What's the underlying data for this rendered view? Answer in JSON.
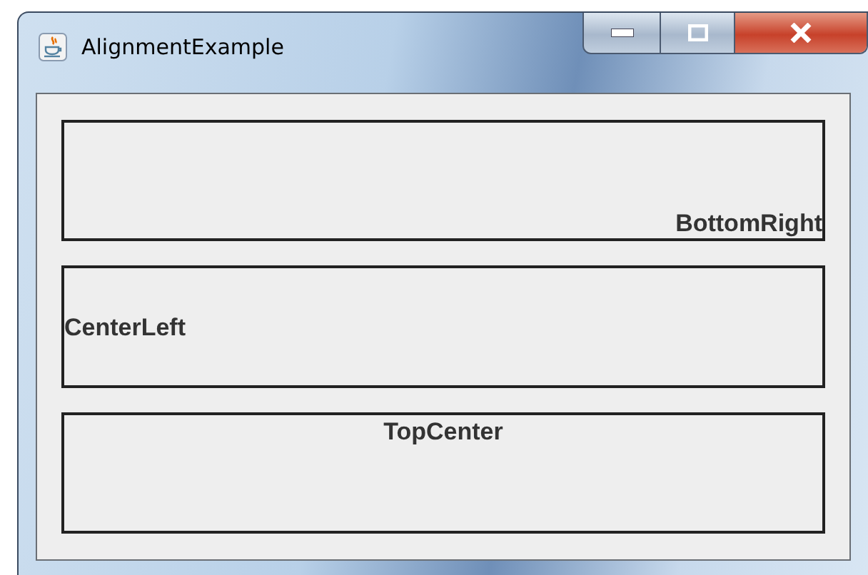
{
  "window": {
    "title": "AlignmentExample"
  },
  "labels": [
    {
      "text": "BottomRight",
      "kind": "bottomright"
    },
    {
      "text": "CenterLeft",
      "kind": "centerleft"
    },
    {
      "text": "TopCenter",
      "kind": "topcenter"
    }
  ]
}
